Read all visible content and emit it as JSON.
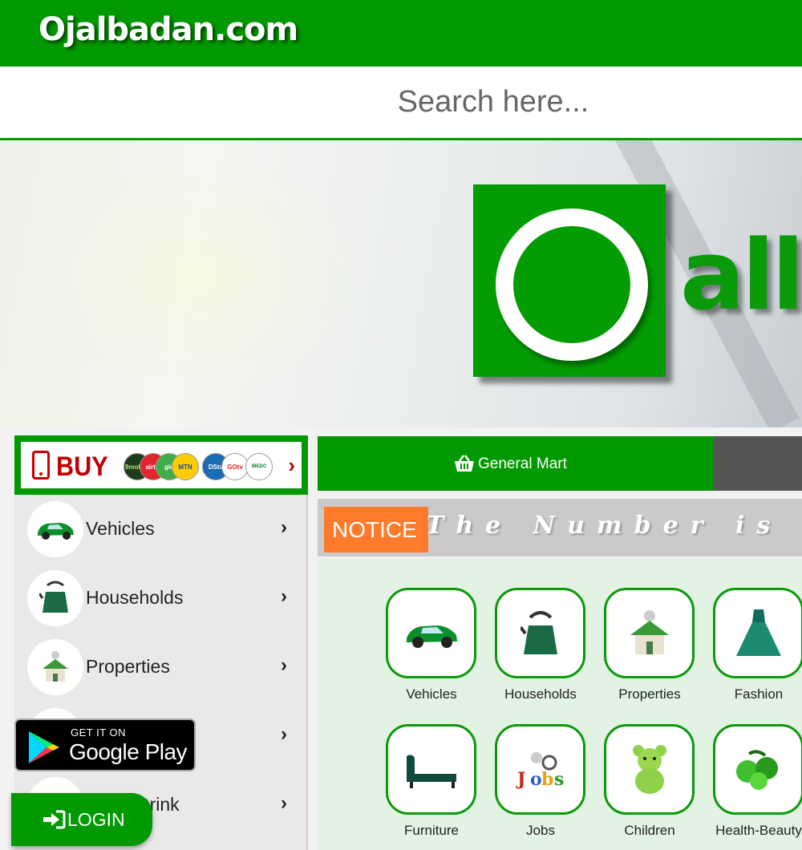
{
  "header": {
    "site_title": "Ojalbadan.com"
  },
  "search": {
    "placeholder": "Search here..."
  },
  "banner": {
    "logo_text": "all"
  },
  "buy": {
    "label": "BUY",
    "carriers": [
      "9mobile",
      "airtel",
      "glo",
      "MTN",
      "DStv",
      "GOtv",
      "IBEDC"
    ]
  },
  "sidebar": {
    "items": [
      {
        "label": "Vehicles",
        "icon": "car-icon"
      },
      {
        "label": "Households",
        "icon": "kettle-icon"
      },
      {
        "label": "Properties",
        "icon": "house-icon"
      },
      {
        "label": "",
        "icon": "category-icon"
      },
      {
        "label": "Drink",
        "icon": "drink-icon"
      }
    ]
  },
  "google_play": {
    "small": "GET IT ON",
    "big": "Google Play"
  },
  "login": {
    "label": "LOGIN"
  },
  "tabs": {
    "general": "General Mart"
  },
  "notice": {
    "tag": "NOTICE",
    "text": "The Number is GRO"
  },
  "grid": {
    "items": [
      {
        "label": "Vehicles",
        "icon": "car-icon"
      },
      {
        "label": "Households",
        "icon": "kettle-icon"
      },
      {
        "label": "Properties",
        "icon": "house-icon"
      },
      {
        "label": "Fashion",
        "icon": "gown-icon"
      },
      {
        "label": "Furniture",
        "icon": "sofa-icon"
      },
      {
        "label": "Jobs",
        "icon": "jobs-icon"
      },
      {
        "label": "Children",
        "icon": "teddy-bear-icon"
      },
      {
        "label": "Health-Beauty",
        "icon": "fruits-icon"
      }
    ]
  },
  "colors": {
    "brand_green": "#029902",
    "notice_orange": "#ff7a2a",
    "buy_red": "#c00000"
  }
}
